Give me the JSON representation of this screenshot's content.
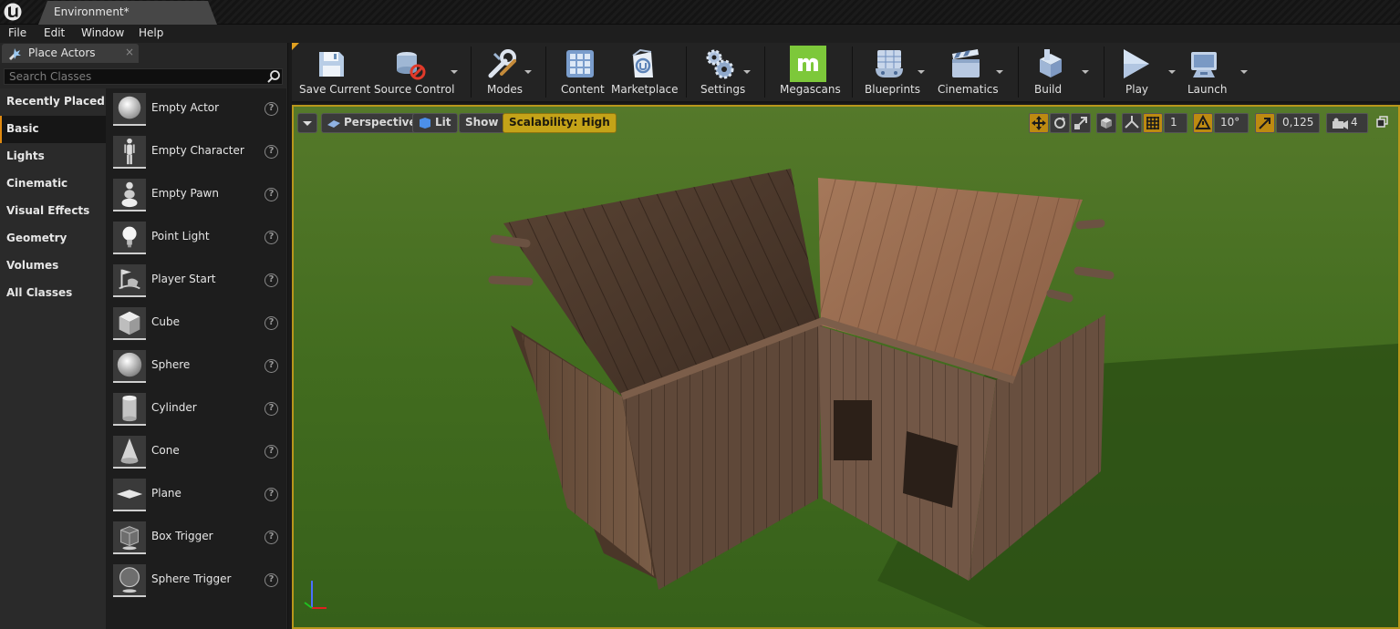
{
  "window": {
    "document_tab": "Environment*"
  },
  "menu": {
    "items": [
      "File",
      "Edit",
      "Window",
      "Help"
    ]
  },
  "place_actors": {
    "tab_label": "Place Actors",
    "close_glyph": "×",
    "search_placeholder": "Search Classes",
    "categories": [
      {
        "label": "Recently Placed"
      },
      {
        "label": "Basic"
      },
      {
        "label": "Lights"
      },
      {
        "label": "Cinematic"
      },
      {
        "label": "Visual Effects"
      },
      {
        "label": "Geometry"
      },
      {
        "label": "Volumes"
      },
      {
        "label": "All Classes"
      }
    ],
    "selected_category": "Basic",
    "actors": [
      {
        "label": "Empty Actor",
        "icon": "sphere-icon"
      },
      {
        "label": "Empty Character",
        "icon": "character-icon"
      },
      {
        "label": "Empty Pawn",
        "icon": "pawn-icon"
      },
      {
        "label": "Point Light",
        "icon": "light-bulb-icon"
      },
      {
        "label": "Player Start",
        "icon": "player-start-icon"
      },
      {
        "label": "Cube",
        "icon": "cube-icon"
      },
      {
        "label": "Sphere",
        "icon": "sphere-icon"
      },
      {
        "label": "Cylinder",
        "icon": "cylinder-icon"
      },
      {
        "label": "Cone",
        "icon": "cone-icon"
      },
      {
        "label": "Plane",
        "icon": "plane-icon"
      },
      {
        "label": "Box Trigger",
        "icon": "box-trigger-icon"
      },
      {
        "label": "Sphere Trigger",
        "icon": "sphere-trigger-icon"
      }
    ],
    "help_glyph": "?"
  },
  "toolbar": {
    "buttons": [
      {
        "label": "Save Current",
        "icon": "save-icon"
      },
      {
        "label": "Source Control",
        "icon": "source-control-icon"
      },
      {
        "label": "Modes",
        "icon": "modes-icon"
      },
      {
        "label": "Content",
        "icon": "content-icon"
      },
      {
        "label": "Marketplace",
        "icon": "marketplace-icon"
      },
      {
        "label": "Settings",
        "icon": "settings-icon"
      },
      {
        "label": "Megascans",
        "icon": "megascans-icon"
      },
      {
        "label": "Blueprints",
        "icon": "blueprints-icon"
      },
      {
        "label": "Cinematics",
        "icon": "cinematics-icon"
      },
      {
        "label": "Build",
        "icon": "build-icon"
      },
      {
        "label": "Play",
        "icon": "play-icon"
      },
      {
        "label": "Launch",
        "icon": "launch-icon"
      }
    ]
  },
  "viewport": {
    "perspective_label": "Perspective",
    "lit_label": "Lit",
    "show_label": "Show",
    "scalability_label": "Scalability: High",
    "grid_snap_value": "1",
    "rotation_snap_value": "10°",
    "scale_snap_value": "0,125",
    "camera_speed_value": "4",
    "colors": {
      "border": "#b8961c",
      "highlight": "#bd8a11",
      "scalability_bg": "#c4a318",
      "grass": "#3f6b1c"
    }
  }
}
